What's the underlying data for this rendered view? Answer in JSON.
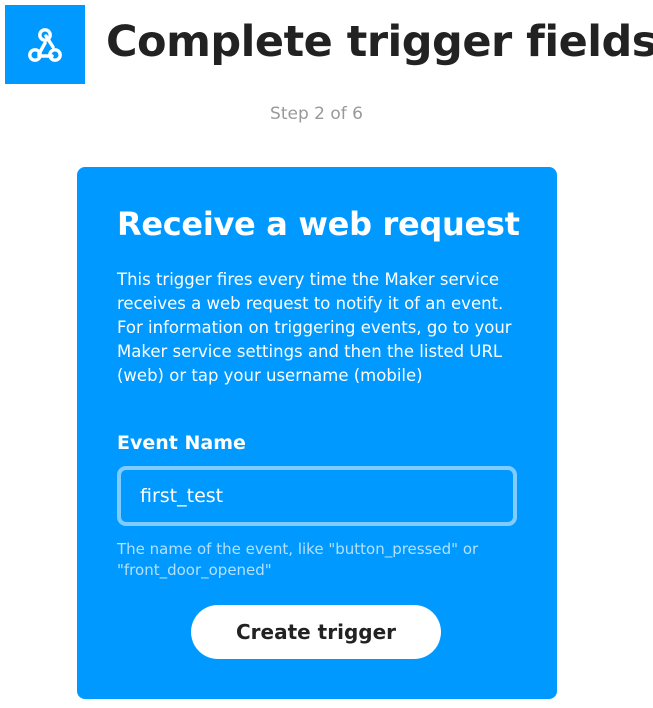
{
  "header": {
    "service_icon": "webhook-icon",
    "title": "Complete trigger fields",
    "step": "Step 2 of 6"
  },
  "card": {
    "title": "Receive a web request",
    "description": "This trigger fires every time the Maker service receives a web request to notify it of an event. For information on triggering events, go to your Maker service settings and then the listed URL (web) or tap your username (mobile)",
    "field": {
      "label": "Event Name",
      "value": "first_test",
      "help": "The name of the event, like \"button_pressed\" or \"front_door_opened\""
    },
    "button_label": "Create trigger"
  },
  "colors": {
    "brand_blue": "#0099ff",
    "title_text": "#222222",
    "step_text": "#999999",
    "input_border": "#80ccff",
    "help_text": "#b3e0ff"
  }
}
